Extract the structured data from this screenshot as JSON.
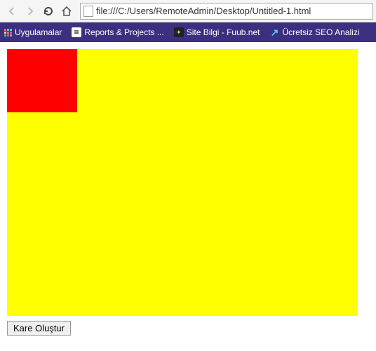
{
  "browser": {
    "url": "file:///C:/Users/RemoteAdmin/Desktop/Untitled-1.html"
  },
  "bookmarks": {
    "apps": "Uygulamalar",
    "reports": "Reports & Projects ...",
    "sitebilgi": "Site Bilgi - Fuub.net",
    "seo": "Ücretsiz SEO Analizi"
  },
  "page": {
    "button_label": "Kare Oluştur"
  }
}
